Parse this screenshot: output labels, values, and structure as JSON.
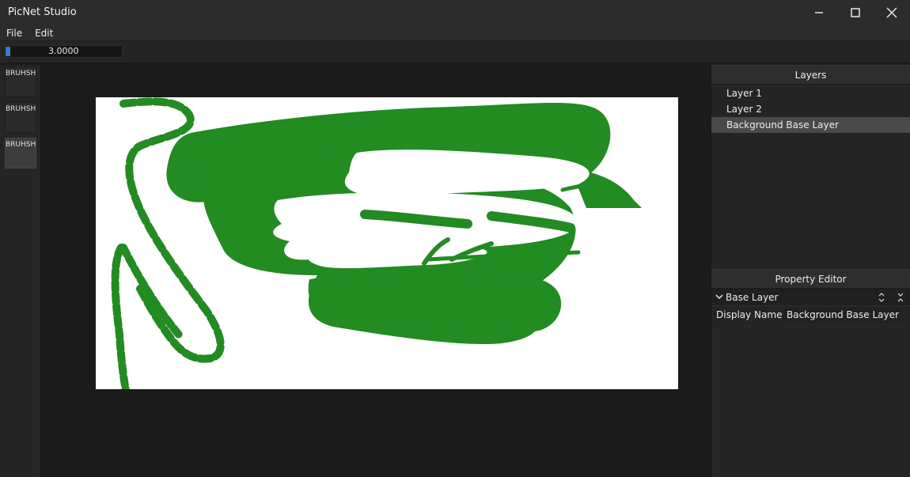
{
  "app": {
    "title": "PicNet Studio"
  },
  "menu": [
    "File",
    "Edit"
  ],
  "toolbar": {
    "value_text": "3.0000",
    "value_fraction": 0.04,
    "accent": "#2f7fd6"
  },
  "brushes": [
    {
      "label": "BRUHSH",
      "active": false
    },
    {
      "label": "BRUHSH",
      "active": false
    },
    {
      "label": "BRUHSH",
      "active": true
    }
  ],
  "canvas": {
    "background": "#ffffff",
    "paint_color": "#228b22"
  },
  "layers": {
    "header": "Layers",
    "items": [
      {
        "label": "Layer 1",
        "selected": false
      },
      {
        "label": "Layer 2",
        "selected": false
      },
      {
        "label": "Background Base Layer",
        "selected": true
      }
    ]
  },
  "property_editor": {
    "header": "Property Editor",
    "group_label": "Base Layer",
    "rows": [
      {
        "name": "Display Name",
        "value": "Background Base Layer"
      }
    ]
  }
}
